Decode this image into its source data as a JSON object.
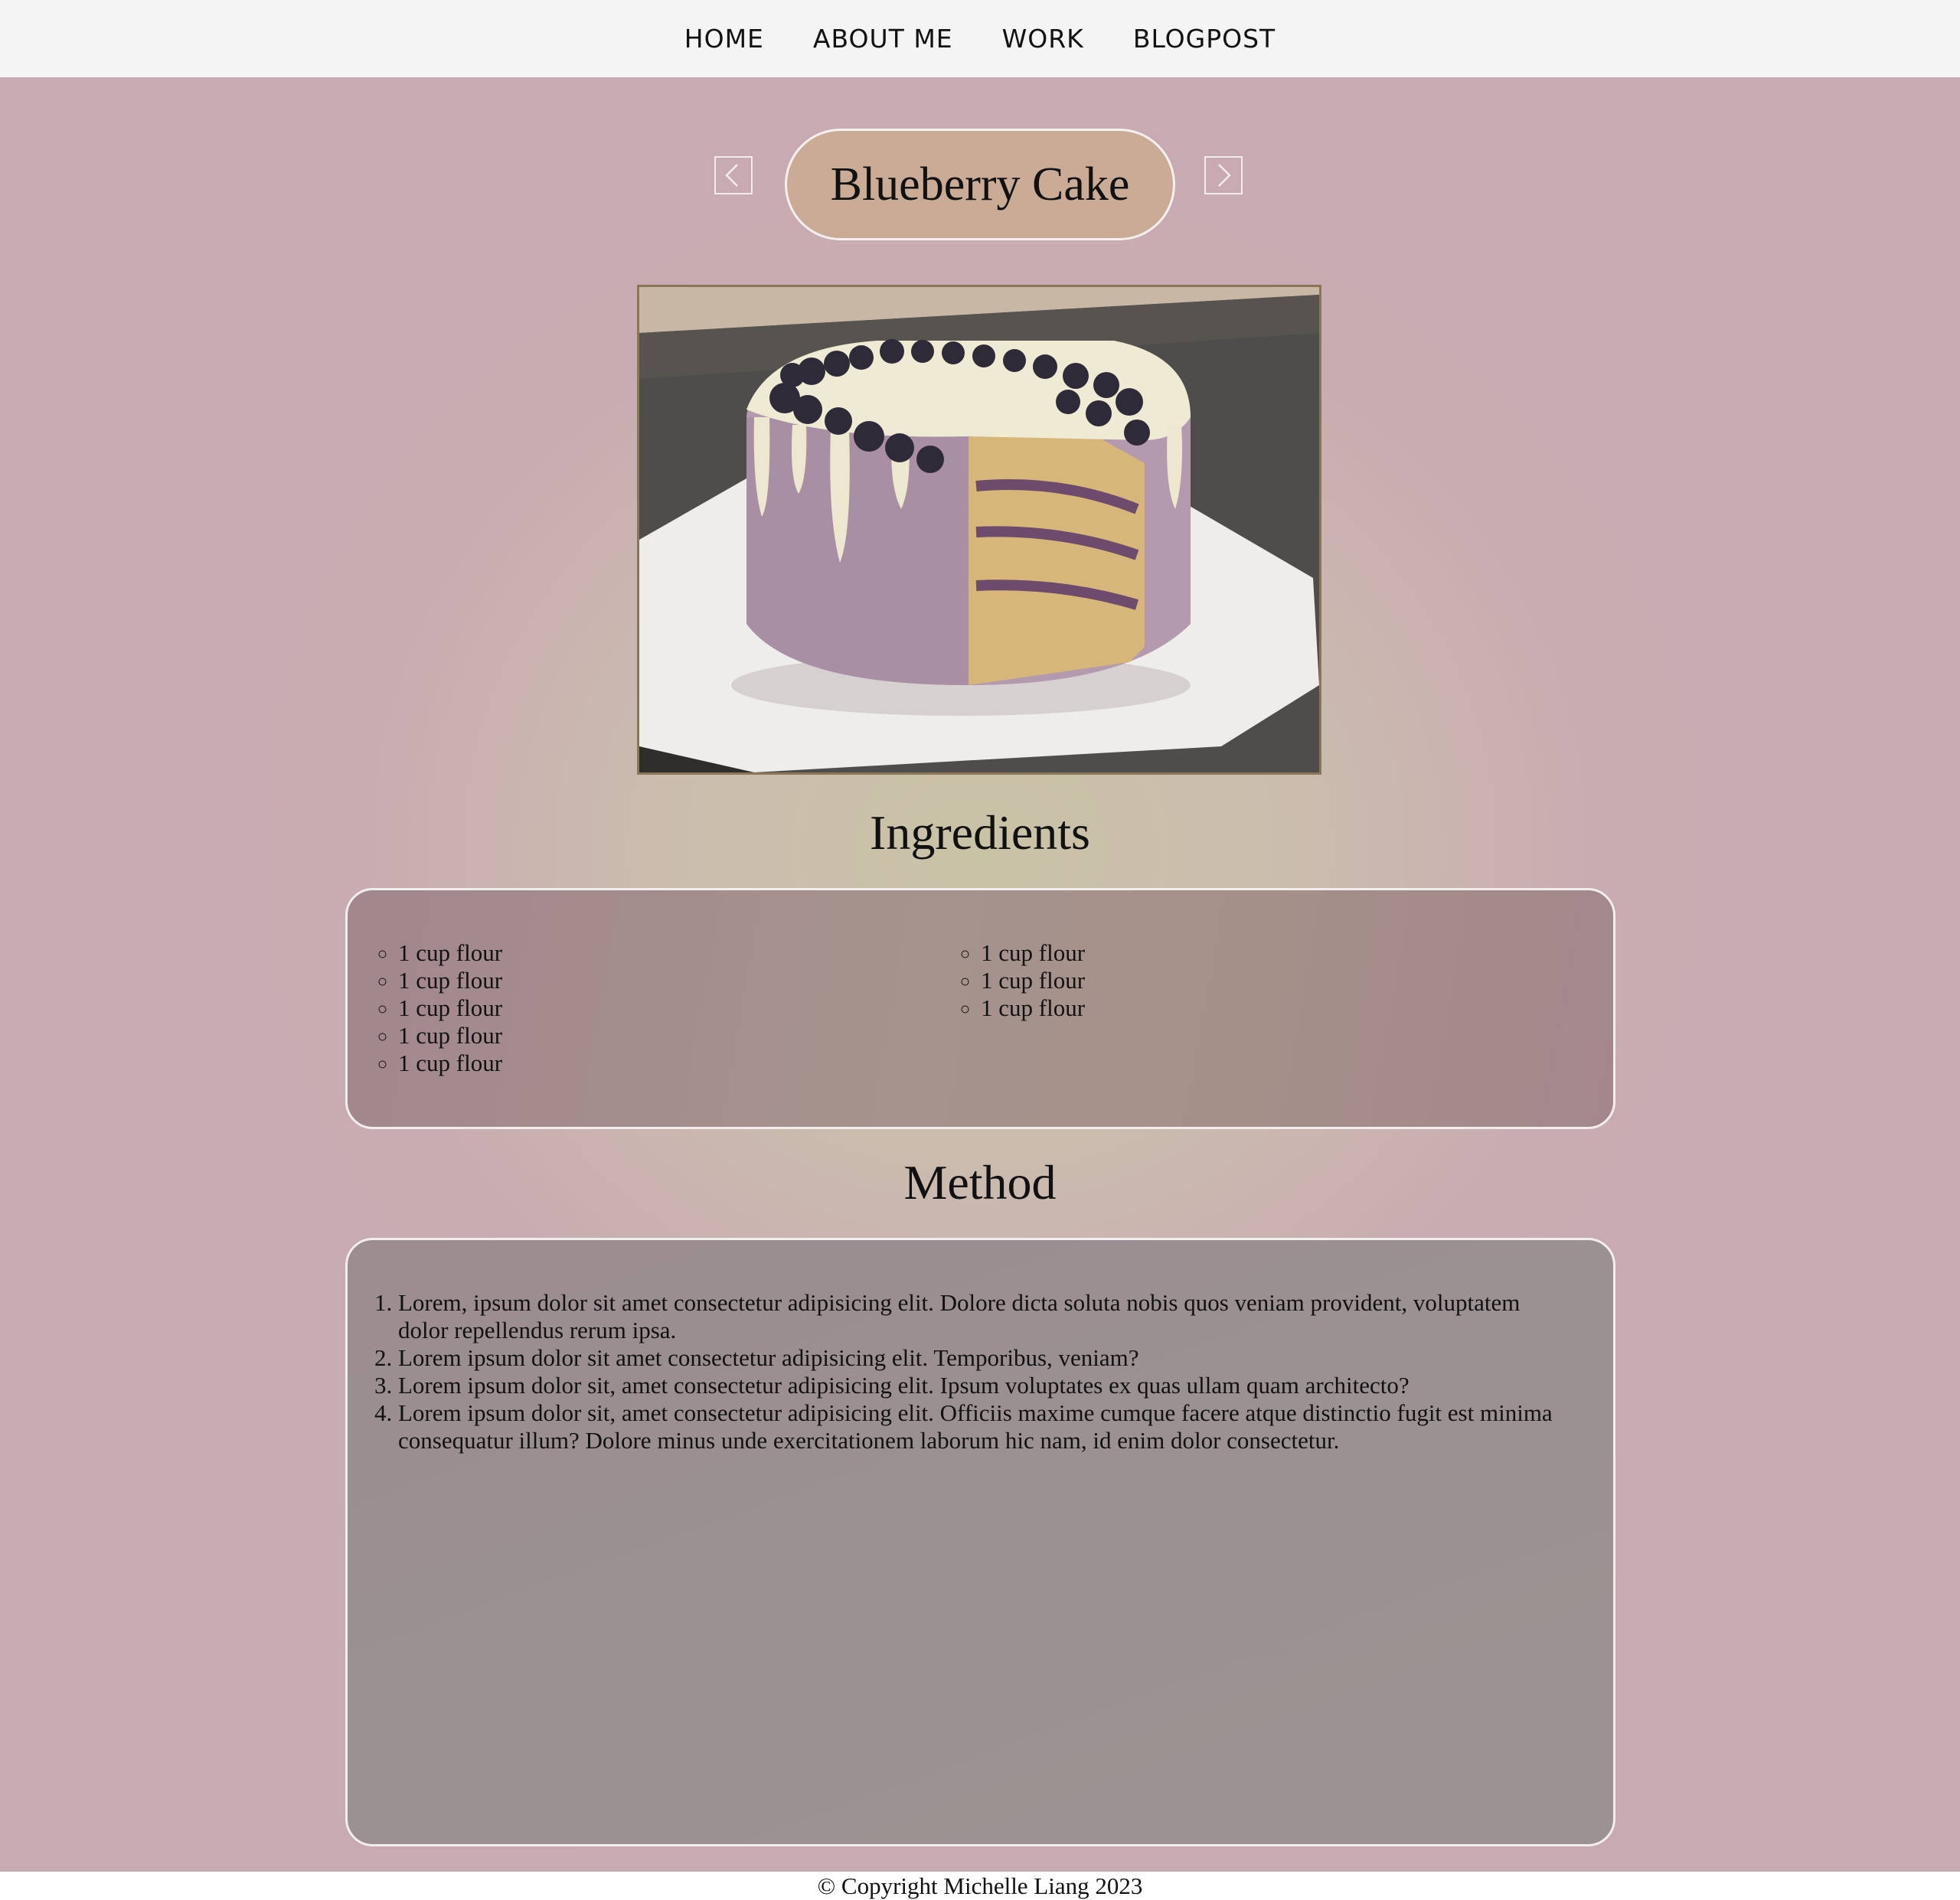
{
  "nav": {
    "items": [
      "HOME",
      "ABOUT ME",
      "WORK",
      "BLOGPOST"
    ]
  },
  "recipe": {
    "title": "Blueberry Cake",
    "prev_icon": "chevron-left-icon",
    "next_icon": "chevron-right-icon"
  },
  "ingredients": {
    "heading": "Ingredients",
    "left": [
      "1 cup flour",
      "1 cup flour",
      "1 cup flour",
      "1 cup flour",
      "1 cup flour"
    ],
    "right": [
      "1 cup flour",
      "1 cup flour",
      "1 cup flour"
    ]
  },
  "method": {
    "heading": "Method",
    "steps": [
      "Lorem, ipsum dolor sit amet consectetur adipisicing elit. Dolore dicta soluta nobis quos veniam provident, voluptatem dolor repellendus rerum ipsa.",
      "Lorem ipsum dolor sit amet consectetur adipisicing elit. Temporibus, veniam?",
      "Lorem ipsum dolor sit, amet consectetur adipisicing elit. Ipsum voluptates ex quas ullam quam architecto?",
      "Lorem ipsum dolor sit, amet consectetur adipisicing elit. Officiis maxime cumque facere atque distinctio fugit est minima consequatur illum? Dolore minus unde exercitationem laborum hic nam, id enim dolor consectetur."
    ]
  },
  "footer": {
    "text": "© Copyright Michelle Liang 2023"
  },
  "colors": {
    "accent_pill": "#c9ab96",
    "page_background": "#c8aab2"
  }
}
